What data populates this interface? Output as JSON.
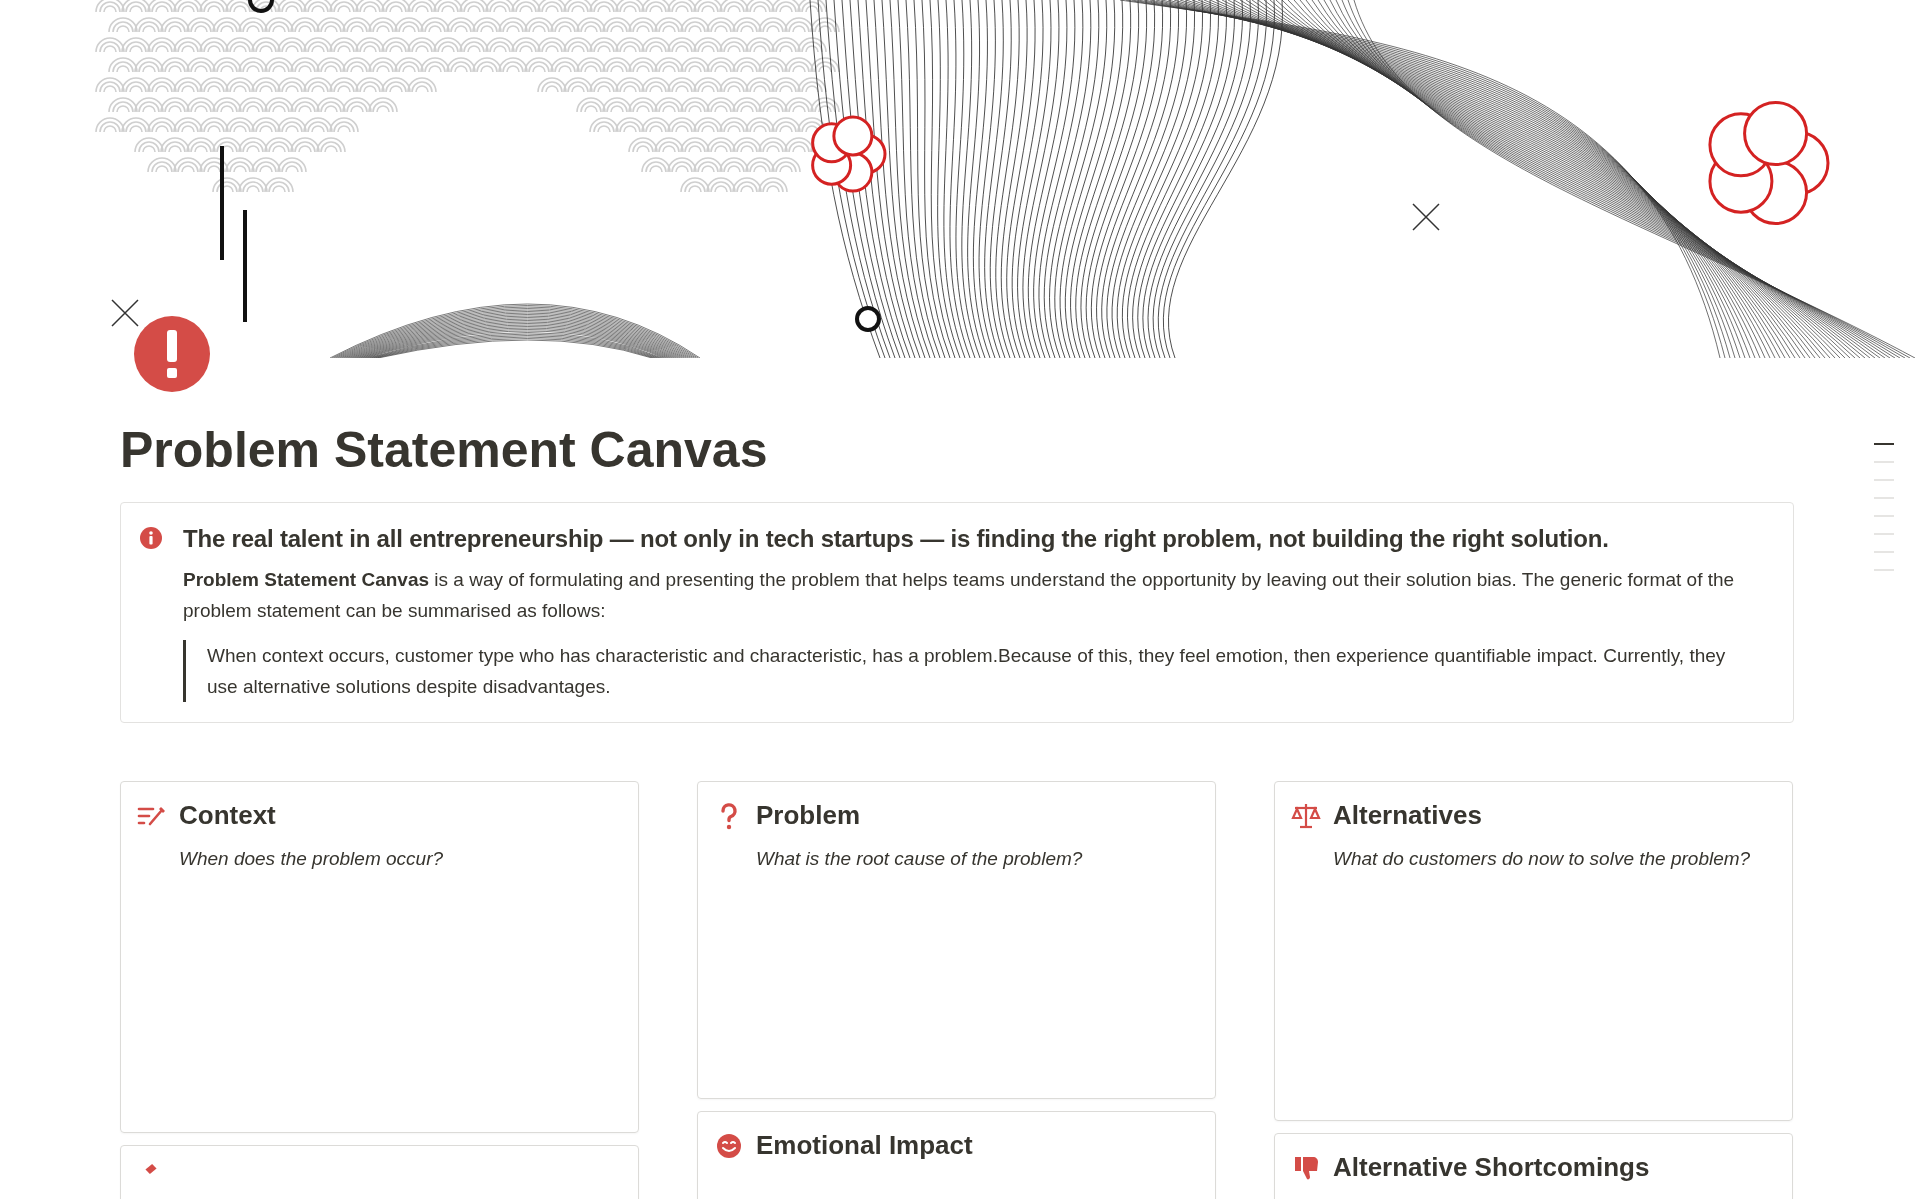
{
  "page": {
    "title": "Problem Statement Canvas"
  },
  "outline_markers": [
    {
      "selected": true
    },
    {
      "selected": false
    },
    {
      "selected": false
    },
    {
      "selected": false
    },
    {
      "selected": false
    },
    {
      "selected": false
    },
    {
      "selected": false
    },
    {
      "selected": false
    }
  ],
  "callout": {
    "heading": "The real talent in all entrepreneurship — not only in tech startups — is finding the right problem, not building the right solution.",
    "body": "**Problem Statement Canvas** is a way of formulating and presenting the problem that helps teams understand the opportunity by leaving out their solution bias. The generic format of the problem statement can be summarised as follows:",
    "quote": "When context occurs, customer type who has characteristic and characteristic, has a problem.Because of this, they feel emotion, then experience quantifiable impact. Currently, they use alternative solutions despite disadvantages."
  },
  "columns": [
    {
      "cards": [
        {
          "kind": "prompt",
          "title": "Context",
          "prompt": "When does the problem occur?"
        },
        {
          "kind": "cut"
        }
      ]
    },
    {
      "cards": [
        {
          "kind": "prompt",
          "title": "Problem",
          "prompt": "What is the root cause of the problem?"
        },
        {
          "kind": "heading",
          "title": "Emotional Impact"
        }
      ]
    },
    {
      "cards": [
        {
          "kind": "prompt",
          "title": "Alternatives",
          "prompt": "What do customers do now to solve the problem?"
        },
        {
          "kind": "heading",
          "title": "Alternative Shortcomings"
        }
      ]
    }
  ]
}
